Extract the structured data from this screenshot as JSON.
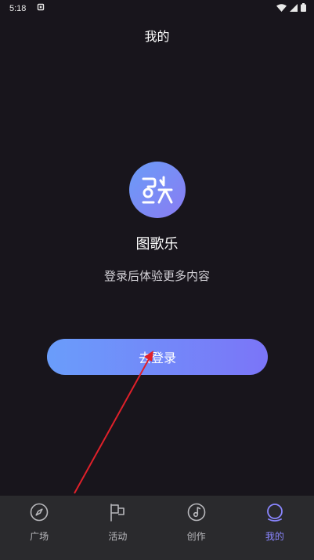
{
  "status_bar": {
    "time": "5:18",
    "icons": [
      "settings-icon",
      "wifi-icon",
      "signal-icon",
      "battery-icon"
    ]
  },
  "header": {
    "title": "我的"
  },
  "profile": {
    "app_name": "图歌乐",
    "prompt": "登录后体验更多内容",
    "login_button_label": "去登录",
    "logo_icon": "app-logo-icon"
  },
  "tab_bar": {
    "items": [
      {
        "label": "广场",
        "icon": "compass-icon",
        "active": false
      },
      {
        "label": "活动",
        "icon": "flag-icon",
        "active": false
      },
      {
        "label": "创作",
        "icon": "music-disc-icon",
        "active": false
      },
      {
        "label": "我的",
        "icon": "profile-icon",
        "active": true
      }
    ]
  },
  "colors": {
    "background": "#18151c",
    "accent": "#8a86ff",
    "button_gradient_start": "#6a9dfa",
    "button_gradient_end": "#7b75f8",
    "tab_bar_bg": "#2a2a2d",
    "annotation_arrow": "#e0202a"
  }
}
